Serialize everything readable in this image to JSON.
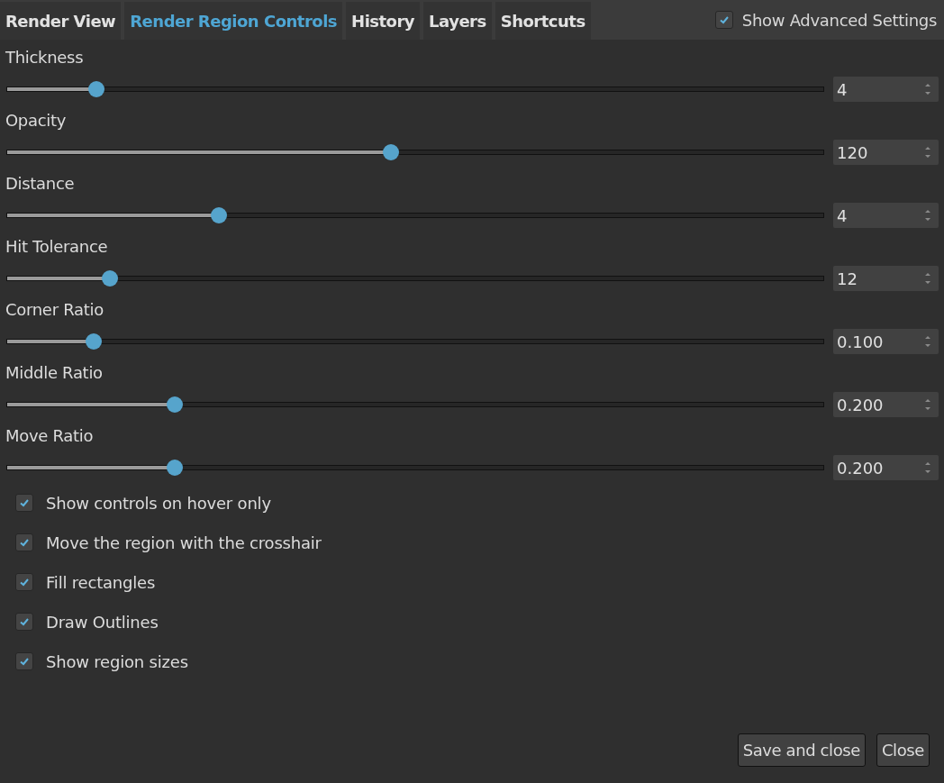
{
  "tabs": [
    {
      "label": "Render View",
      "selected": false
    },
    {
      "label": "Render Region Controls",
      "selected": true
    },
    {
      "label": "History",
      "selected": false
    },
    {
      "label": "Layers",
      "selected": false
    },
    {
      "label": "Shortcuts",
      "selected": false
    }
  ],
  "advanced": {
    "label": "Show Advanced Settings",
    "checked": true
  },
  "sliders": [
    {
      "label": "Thickness",
      "level": 0.11,
      "value": "4"
    },
    {
      "label": "Opacity",
      "level": 0.47,
      "value": "120"
    },
    {
      "label": "Distance",
      "level": 0.26,
      "value": "4"
    },
    {
      "label": "Hit Tolerance",
      "level": 0.127,
      "value": "12"
    },
    {
      "label": "Corner Ratio",
      "level": 0.107,
      "value": "0.100"
    },
    {
      "label": "Middle Ratio",
      "level": 0.206,
      "value": "0.200"
    },
    {
      "label": "Move Ratio",
      "level": 0.206,
      "value": "0.200"
    }
  ],
  "options": [
    {
      "label": "Show controls on hover only",
      "checked": true
    },
    {
      "label": "Move the region with the crosshair",
      "checked": true
    },
    {
      "label": "Fill rectangles",
      "checked": true
    },
    {
      "label": "Draw Outlines",
      "checked": true
    },
    {
      "label": "Show region sizes",
      "checked": true
    }
  ],
  "buttons": [
    "Save and close",
    "Close"
  ]
}
